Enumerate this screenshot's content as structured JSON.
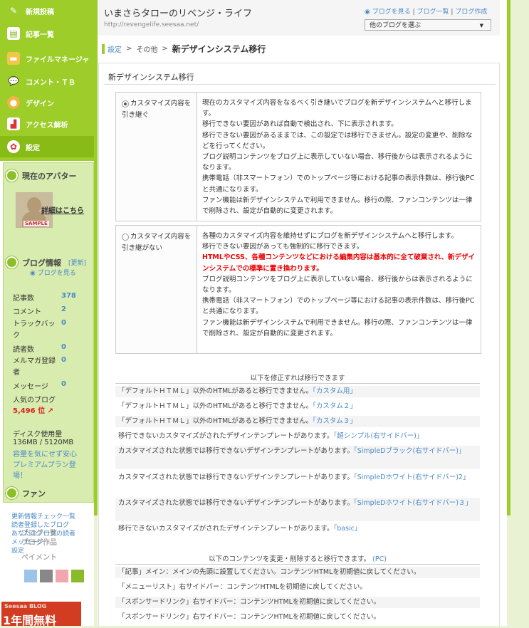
{
  "nav": {
    "items": [
      {
        "label": "新規投稿",
        "icon": "pencil-icon"
      },
      {
        "label": "記事一覧",
        "icon": "document-icon"
      },
      {
        "label": "ファイルマネージャ",
        "icon": "folder-icon"
      },
      {
        "label": "コメント・ＴＢ",
        "icon": "comment-icon"
      },
      {
        "label": "デザイン",
        "icon": "palette-icon"
      },
      {
        "label": "アクセス解析",
        "icon": "chart-icon"
      },
      {
        "label": "設定",
        "icon": "gear-icon"
      }
    ]
  },
  "avatar_panel": {
    "title": "現在のアバター",
    "avatar_tag": "SAMPLE",
    "details_link": "詳細はこちら"
  },
  "blog_info": {
    "title": "ブログ情報",
    "update_link": "[更新]",
    "view_link": "ブログを見る",
    "stats": [
      {
        "label": "記事数",
        "value": "378"
      },
      {
        "label": "コメント",
        "value": "2"
      },
      {
        "label": "トラックバック",
        "value": "0"
      },
      {
        "label": "読者数",
        "value": "0"
      },
      {
        "label": "メルマガ登録者",
        "value": "0"
      },
      {
        "label": "メッセージ",
        "value": "0"
      }
    ],
    "ranking_label": "人気のブログ",
    "ranking_value": "5,496 位",
    "disk_label": "ディスク使用量",
    "disk_value": "136MB / 5120MB",
    "premium_link": "容量を気にせず安心プレミアムプラン登場！"
  },
  "fan_panel": {
    "title": "ファン"
  },
  "bottom_links": [
    "更新情報チェック一覧",
    "読者登録したブログ",
    "あなたのブログの読者",
    "メッセージ",
    "設定"
  ],
  "bottom_overlay": [
    "ブログ一覧",
    "ブログ作品",
    "ペイメント"
  ],
  "banner": {
    "top": "Seesaa BLOG",
    "main": "1年間無料"
  },
  "header": {
    "blog_title": "いまさらタローのリベンジ・ライフ",
    "blog_url": "http://revengelife.seesaa.net/",
    "view_blog": "ブログを見る",
    "blog_list": "ブログ一覧",
    "blog_create": "ブログ作成",
    "select_other": "他のブログを選ぶ"
  },
  "breadcrumb": {
    "settings": "設定",
    "other": "その他",
    "current": "新デザインシステム移行"
  },
  "panel_title": "新デザインシステム移行",
  "option1": {
    "label": "カスタマイズ内容を引き継ぐ",
    "lines": [
      "現在のカスタマイズ内容をなるべく引き継いでブログを新デザインシステムへと移行します。",
      "移行できない要因があれば自動で検出され、下に表示されます。",
      "移行できない要因があるままでは、この設定では移行できません。設定の変更や、削除などを行ってください。",
      "ブログ説明コンテンツをブログ上に表示していない場合、移行後からは表示されるようになります。",
      "携帯電話（非スマートフォン）でのトップページ等における記事の表示件数は、移行後PCと共通になります。",
      "ファン機能は新デザインシステムで利用できません。移行の際、ファンコンテンツは一律で削除され、設定が自動的に変更されます。"
    ]
  },
  "option2": {
    "label": "カスタマイズ内容を引き継がない",
    "line1": "各種のカスタマイズ内容を維持せずにブログを新デザインシステムへと移行します。",
    "line2": "移行できない要因があっても強制的に移行できます。",
    "warning": "HTMLやCSS、各種コンテンツなどにおける編集内容は基本的に全て破棄され、新デザインシステムでの標準に置き換わります。",
    "line3": "ブログ説明コンテンツをブログ上に表示していない場合、移行後からは表示されるようになります。",
    "line4": "携帯電話（非スマートフォン）でのトップページ等における記事の表示件数は、移行後PCと共通になります。",
    "line5": "ファン機能は新デザインシステムで利用できません。移行の際、ファンコンテンツは一律で削除され、設定が自動的に変更されます。"
  },
  "fix_section": {
    "title": "以下を修正すれば移行できます",
    "rows": [
      {
        "text": "「デフォルトＨＴＭＬ」以外のHTMLがあると移行できません。",
        "link": "「カスタム用」"
      },
      {
        "text": "「デフォルトＨＴＭＬ」以外のHTMLがあると移行できません。",
        "link": "「カスタム２」"
      },
      {
        "text": "「デフォルトＨＴＭＬ」以外のHTMLがあると移行できません。",
        "link": "「カスタム３」"
      },
      {
        "text": "移行できないカスタマイズがされたデザインテンプレートがあります。",
        "link": "「超シンプル(右サイドバー)」"
      },
      {
        "text": "カスタマイズされた状態では移行できないデザインテンプレートがあります。",
        "link": "「SimpleDブラック(右サイドバー)」"
      },
      {
        "text": "カスタマイズされた状態では移行できないデザインテンプレートがあります。",
        "link": "「SimpleDホワイト(右サイドバー)2」"
      },
      {
        "text": "カスタマイズされた状態では移行できないデザインテンプレートがあります。",
        "link": "「SimpleDホワイト(右サイドバー)３」"
      },
      {
        "text": "移行できないカスタマイズがされたデザインテンプレートがあります。",
        "link": "「basic」"
      }
    ]
  },
  "content_section": {
    "title": "以下のコンテンツを変更・削除すると移行できます。",
    "title_tag": "(PC)",
    "rows": [
      "「記事」メイン：メインの先頭に設置してください。コンテンツHTMLを初期値に戻してください。",
      "「メニューリスト」右サイドバー：コンテンツHTMLを初期値に戻してください。",
      "「スポンサードリンク」右サイドバー：コンテンツHTMLを初期値に戻してください。",
      "「スポンサードリンク」右サイドバー：コンテンツHTMLを初期値に戻してください。"
    ]
  }
}
